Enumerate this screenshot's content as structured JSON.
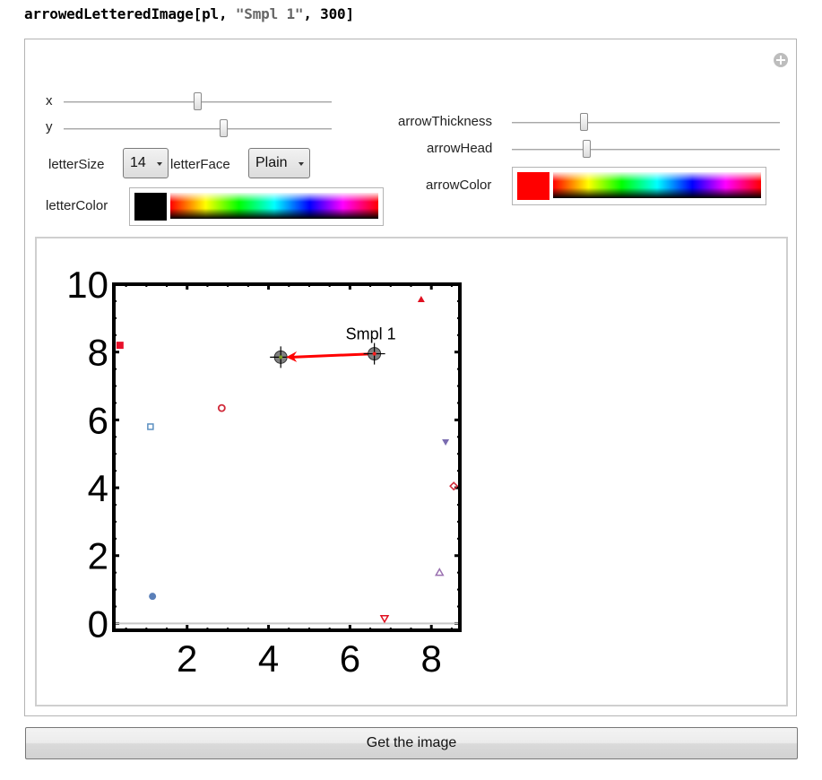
{
  "code": {
    "func": "arrowedLetteredImage",
    "open": "[pl, ",
    "string_arg": "\"Smpl 1\"",
    "close": ", 300]"
  },
  "panel": {
    "expand_icon": "plus-circle-icon",
    "controls": {
      "x": {
        "label": "x",
        "value_fraction": 0.5
      },
      "y": {
        "label": "y",
        "value_fraction": 0.6
      },
      "letterSize": {
        "label": "letterSize",
        "value": "14"
      },
      "letterFace": {
        "label": "letterFace",
        "value": "Plain"
      },
      "letterColor": {
        "label": "letterColor",
        "value": "#000000"
      },
      "arrowThickness": {
        "label": "arrowThickness",
        "value_fraction": 0.27
      },
      "arrowHead": {
        "label": "arrowHead",
        "value_fraction": 0.28
      },
      "arrowColor": {
        "label": "arrowColor",
        "value": "#ff0000"
      }
    }
  },
  "chart_data": {
    "type": "scatter",
    "title": "",
    "xlabel": "",
    "ylabel": "",
    "xlim": [
      0.2,
      8.7
    ],
    "ylim": [
      -0.2,
      10.0
    ],
    "xticks": [
      "2",
      "4",
      "6",
      "8"
    ],
    "xtick_values": [
      2,
      4,
      6,
      8
    ],
    "yticks": [
      "0",
      "2",
      "4",
      "6",
      "8",
      "10"
    ],
    "ytick_values": [
      0,
      2,
      4,
      6,
      8,
      10
    ],
    "grid": false,
    "frame": true,
    "points": [
      {
        "x": 0.35,
        "y": 8.2,
        "marker": "square-filled",
        "color": "#e8102a"
      },
      {
        "x": 1.1,
        "y": 5.8,
        "marker": "square-open",
        "color": "#5b8fc0"
      },
      {
        "x": 2.85,
        "y": 6.35,
        "marker": "circle-open",
        "color": "#d02838"
      },
      {
        "x": 1.15,
        "y": 0.8,
        "marker": "circle-filled",
        "color": "#5a7fb8"
      },
      {
        "x": 7.75,
        "y": 9.55,
        "marker": "triangle-filled",
        "color": "#e01020"
      },
      {
        "x": 8.35,
        "y": 5.35,
        "marker": "down-triangle-filled",
        "color": "#7a6cb0"
      },
      {
        "x": 8.55,
        "y": 4.05,
        "marker": "diamond-open",
        "color": "#d02838"
      },
      {
        "x": 8.2,
        "y": 1.5,
        "marker": "triangle-open",
        "color": "#9a70b0"
      },
      {
        "x": 6.85,
        "y": 0.15,
        "marker": "down-triangle-open",
        "color": "#e01020"
      }
    ],
    "annotation": {
      "text": "Smpl 1",
      "arrow_from": {
        "x": 6.6,
        "y": 7.95
      },
      "arrow_to": {
        "x": 4.3,
        "y": 7.85
      },
      "arrow_color": "#ff0000"
    }
  },
  "button": {
    "label": "Get the image"
  }
}
